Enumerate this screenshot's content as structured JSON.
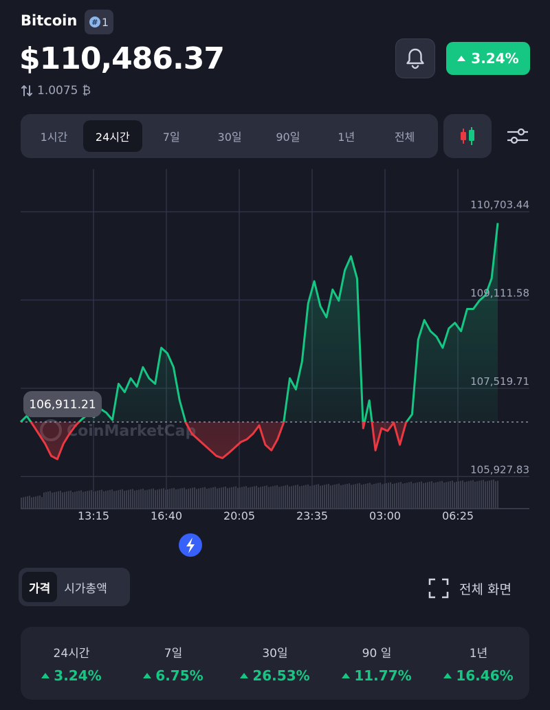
{
  "coin": {
    "name": "Bitcoin",
    "rank": "1",
    "price": "$110,486.37",
    "btc_amount": "1.0075",
    "btc_symbol": "₿",
    "change_24h": "3.24%"
  },
  "colors": {
    "background": "#171924",
    "up": "#16c784",
    "down": "#ea3943",
    "panel": "#2b2e3d"
  },
  "icons": {
    "rank": "hash-icon",
    "bell": "bell-icon",
    "swap": "swap-vertical-icon",
    "candle": "candlestick-icon",
    "settings": "sliders-icon",
    "flash": "lightning-icon",
    "fullscreen": "expand-icon"
  },
  "range_tabs": [
    {
      "label": "1시간",
      "active": false
    },
    {
      "label": "24시간",
      "active": true
    },
    {
      "label": "7일",
      "active": false
    },
    {
      "label": "30일",
      "active": false
    },
    {
      "label": "90일",
      "active": false
    },
    {
      "label": "1년",
      "active": false
    },
    {
      "label": "전체",
      "active": false
    }
  ],
  "chart_data": {
    "type": "line",
    "y_ticks": [
      "110,703.44",
      "109,111.58",
      "107,519.71",
      "105,927.83"
    ],
    "ylim": [
      105200,
      111300
    ],
    "x_ticks": [
      "13:15",
      "16:40",
      "20:05",
      "23:35",
      "03:00",
      "06:25"
    ],
    "open_price": 106911.21,
    "open_label": "106,911.21",
    "watermark": "CoinMarketCap",
    "series": [
      {
        "values": [
          106911,
          107020,
          106860,
          106690,
          106520,
          106300,
          106240,
          106520,
          106700,
          106850,
          106960,
          107050,
          107000,
          107150,
          107080,
          106950,
          107600,
          107450,
          107700,
          107550,
          107900,
          107700,
          107600,
          108250,
          108150,
          107900,
          107300,
          106900,
          106700,
          106600,
          106500,
          106400,
          106300,
          106260,
          106350,
          106450,
          106550,
          106600,
          106700,
          106850,
          106500,
          106400,
          106600,
          106900,
          107700,
          107500,
          108000,
          109050,
          109450,
          109000,
          108800,
          109300,
          109100,
          109650,
          109900,
          109500,
          106800,
          107300,
          106400,
          106800,
          106750,
          106900,
          106500,
          106900,
          107050,
          108400,
          108750,
          108550,
          108450,
          108250,
          108600,
          108700,
          108550,
          108950,
          108950,
          109100,
          109200,
          109500,
          110500
        ]
      }
    ],
    "volume_note": ""
  },
  "price_kind": {
    "price": "가격",
    "market_cap": "시가총액"
  },
  "fullscreen_label": "전체 화면",
  "performance": [
    {
      "label": "24시간",
      "value": "3.24%"
    },
    {
      "label": "7일",
      "value": "6.75%"
    },
    {
      "label": "30일",
      "value": "26.53%"
    },
    {
      "label": "90 일",
      "value": "11.77%"
    },
    {
      "label": "1년",
      "value": "16.46%"
    }
  ]
}
